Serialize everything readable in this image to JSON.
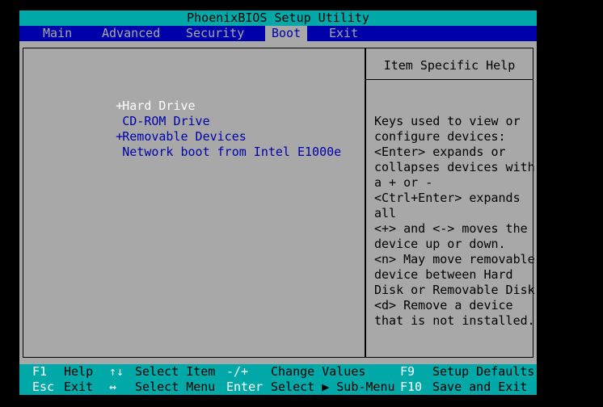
{
  "app": {
    "title": "PhoenixBIOS Setup Utility"
  },
  "menu": [
    {
      "label": "Main"
    },
    {
      "label": "Advanced"
    },
    {
      "label": "Security"
    },
    {
      "label": "Boot"
    },
    {
      "label": "Exit"
    }
  ],
  "boot_order": [
    {
      "marker": "+",
      "label": "Hard Drive",
      "selected": true
    },
    {
      "marker": "",
      "label": "CD-ROM Drive",
      "selected": false
    },
    {
      "marker": "+",
      "label": "Removable Devices",
      "selected": false
    },
    {
      "marker": "",
      "label": "Network boot from Intel E1000e",
      "selected": false
    }
  ],
  "help": {
    "title": "Item Specific Help",
    "lines": [
      "Keys used to view or",
      "configure devices:",
      "<Enter> expands or",
      "collapses devices with",
      "a + or -",
      "<Ctrl+Enter> expands",
      "all",
      "<+> and <-> moves the",
      "device up or down.",
      "<n> May move removable",
      "device between Hard",
      "Disk or Removable Disk",
      "<d> Remove a device",
      "that is not installed."
    ]
  },
  "status": {
    "row1": {
      "k1": "F1",
      "d1": "Help",
      "k2": "↑↓",
      "d2": "Select Item",
      "k3": "-/+",
      "d3": "Change Values",
      "k4": "F9",
      "d4": "Setup Defaults"
    },
    "row2": {
      "k1": "Esc",
      "d1": "Exit",
      "k2": "↔",
      "d2": "Select Menu",
      "k3": "Enter",
      "d3": "Select ▶ Sub-Menu",
      "k4": "F10",
      "d4": "Save and Exit"
    }
  },
  "colors": {
    "cyan": "#00a8a8",
    "blue": "#0000aa",
    "gray": "#a8a8a8",
    "white": "#ffffff"
  }
}
